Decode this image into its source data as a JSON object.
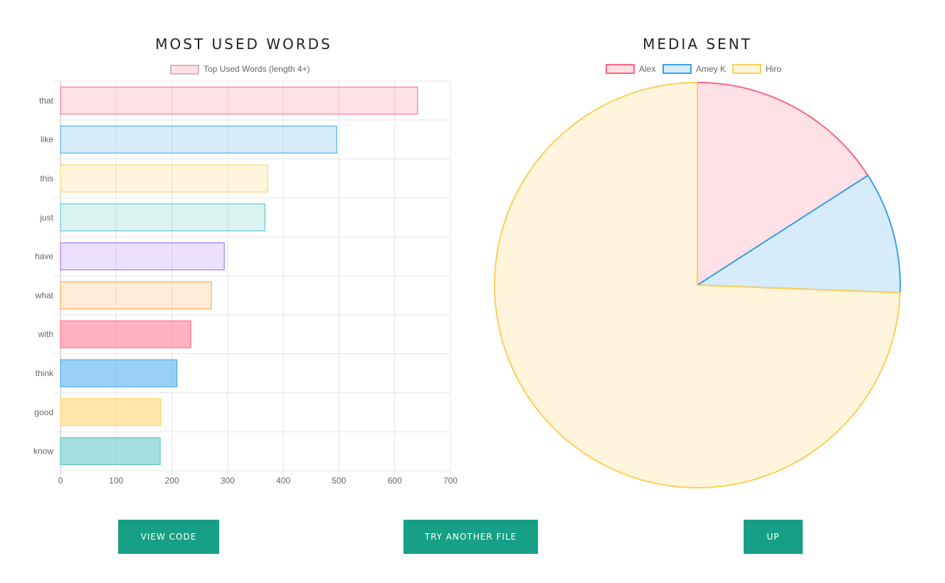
{
  "chart_data": [
    {
      "type": "bar",
      "orientation": "horizontal",
      "title": "MOST USED WORDS",
      "legend": [
        "Top Used Words (length 4+)"
      ],
      "categories": [
        "that",
        "like",
        "this",
        "just",
        "have",
        "what",
        "with",
        "think",
        "good",
        "know"
      ],
      "series": [
        {
          "name": "Top Used Words (length 4+)",
          "values": [
            641,
            496,
            372,
            367,
            294,
            271,
            234,
            209,
            180,
            179
          ]
        }
      ],
      "xlim": [
        0,
        700
      ],
      "xticks": [
        0,
        100,
        200,
        300,
        400,
        500,
        600,
        700
      ],
      "grid": true,
      "legend_position": "top",
      "colors": {
        "border": [
          "#ff6384",
          "#36a2eb",
          "#ffce56",
          "#4bc0c0",
          "#9966ff",
          "#ff9f40",
          "#ff6384",
          "#36a2eb",
          "#ffce56",
          "#4bc0c0"
        ],
        "fill": [
          "rgba(255,99,132,0.2)",
          "rgba(54,162,235,0.2)",
          "rgba(255,206,86,0.2)",
          "rgba(75,192,192,0.2)",
          "rgba(153,102,255,0.2)",
          "rgba(255,159,64,0.2)",
          "rgba(255,99,132,0.5)",
          "rgba(54,162,235,0.5)",
          "rgba(255,206,86,0.5)",
          "rgba(75,192,192,0.5)"
        ]
      }
    },
    {
      "type": "pie",
      "title": "MEDIA SENT",
      "legend_position": "top",
      "labels": [
        "Alex",
        "Amey K",
        "Hiro"
      ],
      "values_percent": [
        15.9,
        9.7,
        74.4
      ],
      "colors": {
        "border": [
          "#ff6384",
          "#36a2eb",
          "#ffce56"
        ],
        "fill": [
          "#ffe0e6",
          "#d7ecfb",
          "#fff5dd"
        ]
      }
    }
  ],
  "buttons": {
    "view_code": "VIEW CODE",
    "try_another": "TRY ANOTHER FILE",
    "up": "UP"
  }
}
